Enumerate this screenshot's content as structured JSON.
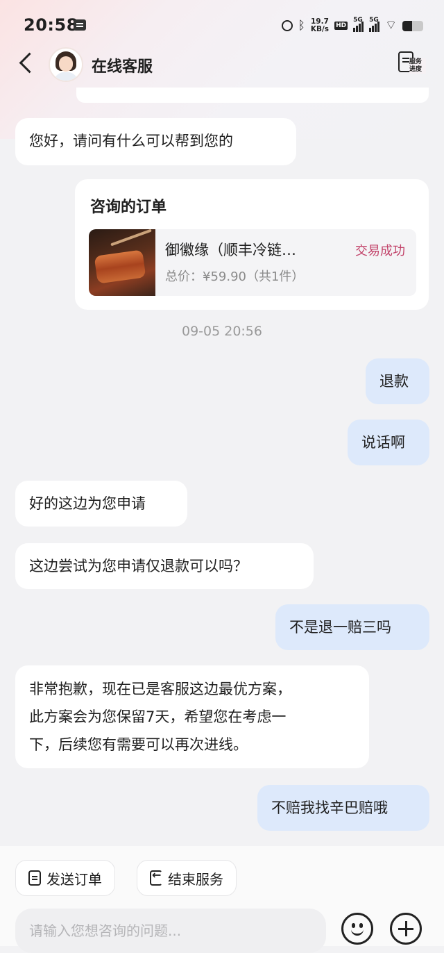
{
  "status_bar": {
    "time": "20:58",
    "net_speed_value": "19.7",
    "net_speed_unit": "KB/s",
    "hd_label": "HD",
    "sim1_label": "5G",
    "sim2_label": "5G",
    "icons": [
      "message-icon",
      "alarm-icon",
      "bluetooth-icon",
      "signal-icon",
      "wifi-icon",
      "battery-icon"
    ]
  },
  "header": {
    "title": "在线客服",
    "progress_label": "服务进度"
  },
  "messages": [
    {
      "side": "left",
      "text": "您好，请问有什么可以帮到您的"
    },
    {
      "side": "right",
      "text": "退款"
    },
    {
      "side": "right",
      "text": "说话啊"
    },
    {
      "side": "left",
      "text": "好的这边为您申请"
    },
    {
      "side": "left",
      "text": "这边尝试为您申请仅退款可以吗？"
    },
    {
      "side": "right",
      "text": "不是退一赔三吗"
    },
    {
      "side": "left",
      "text_lines": [
        "非常抱歉，现在已是客服这边最优方案，",
        "此方案会为您保留7天，希望您在考虑一",
        "下，后续您有需要可以再次进线。"
      ]
    },
    {
      "side": "right",
      "text": "不赔我找辛巴赔哦"
    }
  ],
  "order_card": {
    "title": "咨询的订单",
    "item_name": "御徽缘（顺丰冷链…",
    "status": "交易成功",
    "status_color": "#c2436a",
    "price": "总价：¥59.90（共1件）"
  },
  "timestamp": "09-05 20:56",
  "bottom": {
    "send_order": "发送订单",
    "end_service": "结束服务",
    "input_placeholder": "请输入您想咨询的问题..."
  },
  "colors": {
    "user_bubble": "#dde9fb",
    "agent_bubble": "#ffffff",
    "background": "#f2f2f4"
  }
}
